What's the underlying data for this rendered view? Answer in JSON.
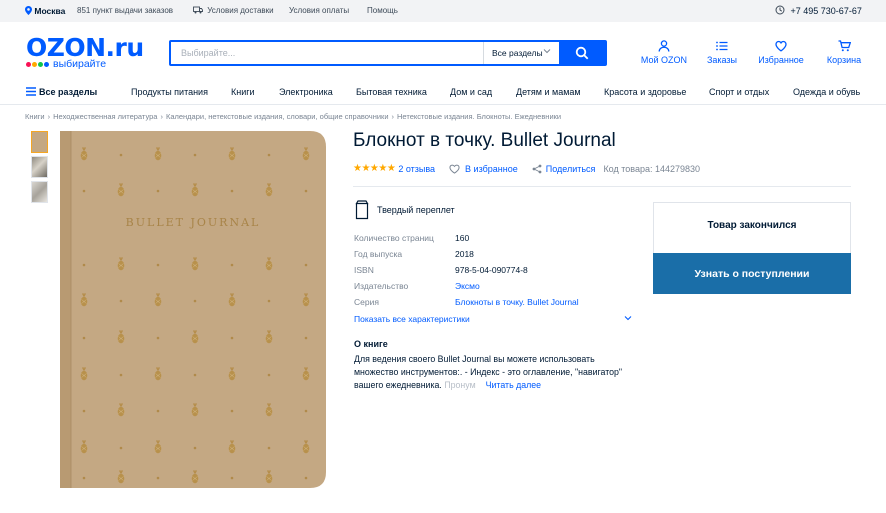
{
  "topbar": {
    "city": "Москва",
    "pickup": "851 пункт выдачи заказов",
    "delivery": "Условия доставки",
    "payment": "Условия оплаты",
    "help": "Помощь",
    "phone": "+7 495 730-67-67"
  },
  "header": {
    "logo_word": "OZON.ru",
    "logo_tag": "выбирайте",
    "search_placeholder": "Выбирайте...",
    "search_category": "Все разделы",
    "my_ozon": "Мой OZON",
    "orders": "Заказы",
    "favorites": "Избранное",
    "cart": "Корзина"
  },
  "nav": {
    "all": "Все разделы",
    "items": [
      "Продукты питания",
      "Книги",
      "Электроника",
      "Бытовая техника",
      "Дом и сад",
      "Детям и мамам",
      "Красота и здоровье",
      "Спорт и отдых",
      "Одежда и обувь"
    ]
  },
  "breadcrumbs": [
    "Книги",
    "Неходжественная литература",
    "Календари, нетекстовые издания, словари, общие справочники",
    "Нетекстовые издания. Блокноты. Ежедневники"
  ],
  "product": {
    "title": "Блокнот в точку. Bullet Journal",
    "rating": 5,
    "reviews": "2 отзыва",
    "favorite": "В избранное",
    "share": "Поделиться",
    "code": "Код товара: 144279830",
    "cover_text": "BULLET JOURNAL",
    "binding": "Твердый переплет",
    "specs": [
      {
        "key": "Количество страниц",
        "value": "160"
      },
      {
        "key": "Год выпуска",
        "value": "2018"
      },
      {
        "key": "ISBN",
        "value": "978-5-04-090774-8"
      },
      {
        "key": "Издательство",
        "value": "Эксмо"
      },
      {
        "key": "Серия",
        "value": "Блокноты в точку. Bullet Journal"
      }
    ],
    "all_specs": "Показать все характеристики",
    "about_title": "О книге",
    "about_line1": "Для ведения своего Bullet Journal вы можете использовать",
    "about_line2": "множество инструментов:. - Индекс - это оглавление, \"навигатор\"",
    "about_line3": "вашего ежедневника.",
    "about_fade": "Пронум",
    "read_more": "Читать далее"
  },
  "buybox": {
    "out_of_stock": "Товар закончился",
    "notify": "Узнать о поступлении"
  },
  "colors": {
    "brand": "#005bff",
    "notify_button": "#1a6ea8",
    "stars": "#ffa800",
    "cover": "#c4a883"
  }
}
